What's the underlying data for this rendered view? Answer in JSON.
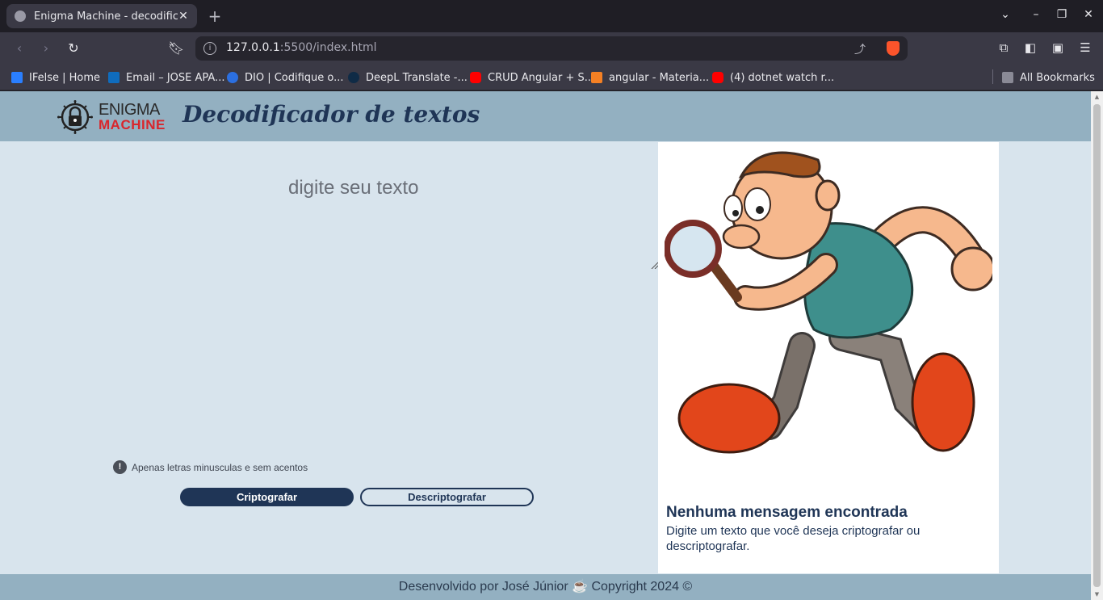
{
  "browser": {
    "tab_title": "Enigma Machine - decodificador",
    "tab_close": "✕",
    "new_tab": "+",
    "url_host": "127.0.0.1",
    "url_rest": ":5500/index.html",
    "bookmarks": [
      {
        "label": "IFelse | Home",
        "color": "#2a7fff"
      },
      {
        "label": "Email – JOSE APA...",
        "color": "#0f6cbd"
      },
      {
        "label": "DIO | Codifique o...",
        "color": "#2b6fe0"
      },
      {
        "label": "DeepL Translate -...",
        "color": "#0f2b46"
      },
      {
        "label": "CRUD Angular + S...",
        "color": "#ff0000"
      },
      {
        "label": "angular - Materia...",
        "color": "#f48024"
      },
      {
        "label": "(4) dotnet watch r...",
        "color": "#ff0000"
      }
    ],
    "all_bookmarks": "All Bookmarks"
  },
  "header": {
    "logo_line1": "ENIGMA",
    "logo_line2": "MACHINE",
    "title": "Decodificador de textos"
  },
  "input": {
    "placeholder": "digite seu texto"
  },
  "hint": {
    "icon": "!",
    "text": "Apenas letras minusculas e sem acentos"
  },
  "buttons": {
    "encrypt": "Criptografar",
    "decrypt": "Descriptografar"
  },
  "output": {
    "title": "Nenhuma mensagem encontrada",
    "body": "Digite um texto que você deseja criptografar ou descriptografar."
  },
  "footer": {
    "text": "Desenvolvido por José Júnior ☕ Copyright 2024 ©"
  },
  "colors": {
    "header_bg": "#93b0c1",
    "page_bg": "#d8e4ed",
    "primary": "#1f3556",
    "logo_red": "#d9262c"
  }
}
